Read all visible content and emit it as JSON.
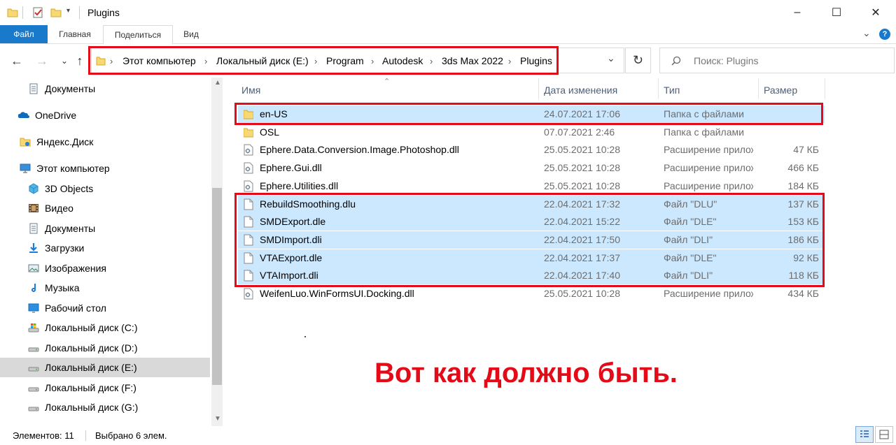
{
  "window": {
    "title": "Plugins",
    "minimize": "–",
    "maximize": "☐",
    "close": "✕"
  },
  "ribbon": {
    "tabs": [
      "Файл",
      "Главная",
      "Поделиться",
      "Вид"
    ],
    "expand": "⌄",
    "help": "?"
  },
  "address": {
    "crumbs": [
      "Этот компьютер",
      "Локальный диск (E:)",
      "Program",
      "Autodesk",
      "3ds Max 2022",
      "Plugins"
    ],
    "separator": "›",
    "dropdown": "⌄",
    "refresh": "↻",
    "search_placeholder": "Поиск: Plugins"
  },
  "nav": {
    "back": "←",
    "forward": "→",
    "recent": "⌄",
    "up": "↑"
  },
  "sidebar": {
    "items": [
      {
        "label": "Документы",
        "icon": "documents-icon"
      },
      {
        "label": "OneDrive",
        "icon": "onedrive-icon"
      },
      {
        "label": "Яндекс.Диск",
        "icon": "yandex-disk-icon"
      },
      {
        "label": "Этот компьютер",
        "icon": "this-pc-icon"
      },
      {
        "label": "3D Objects",
        "icon": "3d-objects-icon"
      },
      {
        "label": "Видео",
        "icon": "video-icon"
      },
      {
        "label": "Документы",
        "icon": "documents-icon"
      },
      {
        "label": "Загрузки",
        "icon": "downloads-icon"
      },
      {
        "label": "Изображения",
        "icon": "pictures-icon"
      },
      {
        "label": "Музыка",
        "icon": "music-icon"
      },
      {
        "label": "Рабочий стол",
        "icon": "desktop-icon"
      },
      {
        "label": "Локальный диск (C:)",
        "icon": "system-drive-icon"
      },
      {
        "label": "Локальный диск (D:)",
        "icon": "drive-icon"
      },
      {
        "label": "Локальный диск (E:)",
        "icon": "drive-icon"
      },
      {
        "label": "Локальный диск (F:)",
        "icon": "drive-icon"
      },
      {
        "label": "Локальный диск (G:)",
        "icon": "drive-icon"
      }
    ],
    "selected_index": 13
  },
  "columns": {
    "name": "Имя",
    "date": "Дата изменения",
    "type": "Тип",
    "size": "Размер"
  },
  "files": [
    {
      "name": "en-US",
      "date": "24.07.2021 17:06",
      "type": "Папка с файлами",
      "size": "",
      "kind": "folder",
      "selected": true
    },
    {
      "name": "OSL",
      "date": "07.07.2021 2:46",
      "type": "Папка с файлами",
      "size": "",
      "kind": "folder",
      "selected": false
    },
    {
      "name": "Ephere.Data.Conversion.Image.Photoshop.dll",
      "date": "25.05.2021 10:28",
      "type": "Расширение приложения",
      "size": "47 КБ",
      "kind": "dll",
      "selected": false
    },
    {
      "name": "Ephere.Gui.dll",
      "date": "25.05.2021 10:28",
      "type": "Расширение приложения",
      "size": "466 КБ",
      "kind": "dll",
      "selected": false
    },
    {
      "name": "Ephere.Utilities.dll",
      "date": "25.05.2021 10:28",
      "type": "Расширение приложения",
      "size": "184 КБ",
      "kind": "dll",
      "selected": false
    },
    {
      "name": "RebuildSmoothing.dlu",
      "date": "22.04.2021 17:32",
      "type": "Файл \"DLU\"",
      "size": "137 КБ",
      "kind": "file",
      "selected": true
    },
    {
      "name": "SMDExport.dle",
      "date": "22.04.2021 15:22",
      "type": "Файл \"DLE\"",
      "size": "153 КБ",
      "kind": "file",
      "selected": true
    },
    {
      "name": "SMDImport.dli",
      "date": "22.04.2021 17:50",
      "type": "Файл \"DLI\"",
      "size": "186 КБ",
      "kind": "file",
      "selected": true
    },
    {
      "name": "VTAExport.dle",
      "date": "22.04.2021 17:37",
      "type": "Файл \"DLE\"",
      "size": "92 КБ",
      "kind": "file",
      "selected": true
    },
    {
      "name": "VTAImport.dli",
      "date": "22.04.2021 17:40",
      "type": "Файл \"DLI\"",
      "size": "118 КБ",
      "kind": "file",
      "selected": true
    },
    {
      "name": "WeifenLuo.WinFormsUI.Docking.dll",
      "date": "25.05.2021 10:28",
      "type": "Расширение приложения",
      "size": "434 КБ",
      "kind": "dll",
      "selected": false
    }
  ],
  "caption": "Вот как должно быть.",
  "status": {
    "count": "Элементов: 11",
    "selected": "Выбрано 6 элем."
  },
  "colors": {
    "accent": "#1979ca",
    "selection": "#cce8ff",
    "highlight": "#e30b17"
  }
}
